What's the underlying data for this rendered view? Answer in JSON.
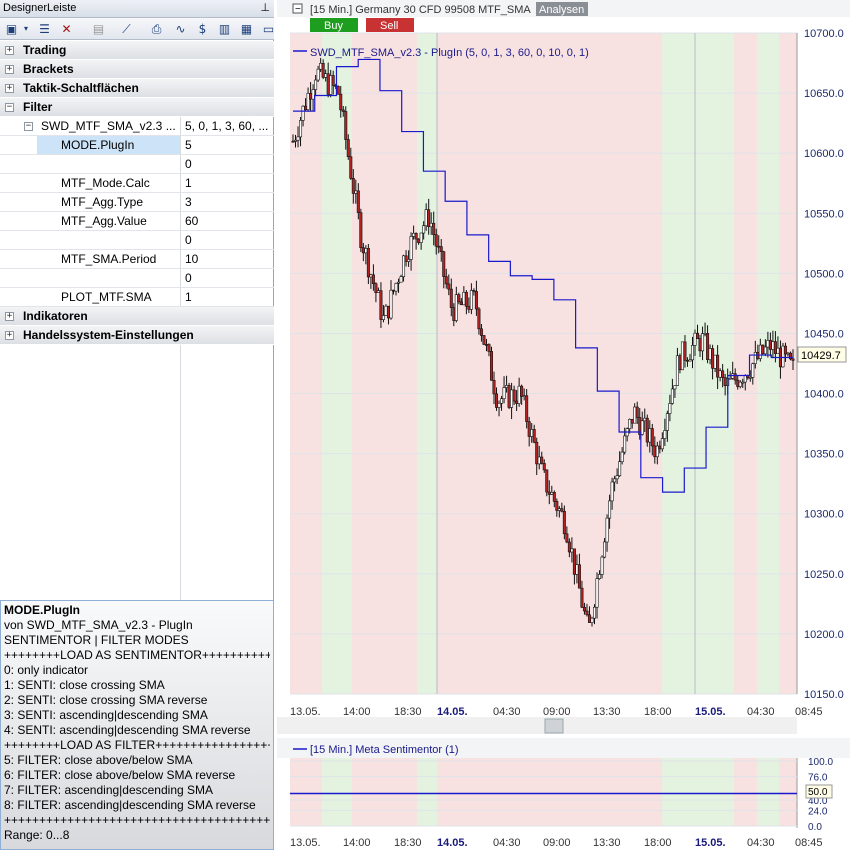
{
  "panel": {
    "title": "DesignerLeiste",
    "categories": {
      "trading": "Trading",
      "brackets": "Brackets",
      "taktik": "Taktik-Schaltflächen",
      "filter": "Filter",
      "indikatoren": "Indikatoren",
      "handelssystem": "Handelssystem-Einstellungen"
    },
    "filter_node": {
      "name": "SWD_MTF_SMA_v2.3 ...",
      "value": "5, 0, 1, 3, 60, ..."
    },
    "params": [
      {
        "name": "MODE.PlugIn",
        "value": "5"
      },
      {
        "name": "",
        "value": "0"
      },
      {
        "name": "MTF_Mode.Calc",
        "value": "1"
      },
      {
        "name": "MTF_Agg.Type",
        "value": "3"
      },
      {
        "name": "MTF_Agg.Value",
        "value": "60"
      },
      {
        "name": "",
        "value": "0"
      },
      {
        "name": "MTF_SMA.Period",
        "value": "10"
      },
      {
        "name": "",
        "value": "0"
      },
      {
        "name": "PLOT_MTF.SMA",
        "value": "1"
      }
    ],
    "description": {
      "title": "MODE.PlugIn",
      "lines": [
        "von SWD_MTF_SMA_v2.3 - PlugIn",
        "SENTIMENTOR | FILTER MODES",
        "++++++++LOAD AS SENTIMENTOR++++++++++",
        "0: only indicator",
        "1: SENTI: close crossing SMA",
        "2: SENTI: close crossing SMA reverse",
        "3: SENTI: ascending|descending SMA",
        "4: SENTI: ascending|descending SMA reverse",
        "++++++++LOAD AS FILTER+++++++++++++++++",
        "5: FILTER: close above/below SMA",
        "6: FILTER: close above/below SMA reverse",
        "7: FILTER: ascending|descending SMA",
        "8: FILTER: ascending|descending SMA reverse",
        "++++++++++++++++++++++++++++++++++++++",
        "Range: 0...8"
      ]
    }
  },
  "chart": {
    "header": "[15 Min.] Germany 30 CFD   99508 MTF_SMA",
    "analysen_label": "Analysen",
    "buy_label": "Buy",
    "sell_label": "Sell",
    "legend": "SWD_MTF_SMA_v2.3 - PlugIn  (5, 0, 1, 3, 60, 0, 10, 0, 1)",
    "last_price": "10429.7",
    "colors": {
      "up": "#ffffff",
      "down": "#b22222",
      "sma": "#1a1acd",
      "bull_zone": "#e3f3e0",
      "bear_zone": "#f8e1e1",
      "buy_btn": "#1e9e1e",
      "sell_btn": "#c83232"
    },
    "sub_header": "[15 Min.] Meta Sentimentor  (1)",
    "sub_value": "50.0",
    "sub_ticks": [
      "100.0",
      "76.0",
      "50.0",
      "40.0",
      "24.0",
      "0.0"
    ],
    "x_ticks": [
      "13.05.",
      "14:00",
      "18:30",
      "14.05.",
      "04:30",
      "09:00",
      "13:30",
      "18:00",
      "15.05.",
      "04:30",
      "08:45"
    ]
  },
  "chart_data": {
    "type": "line",
    "title": "",
    "ylim": [
      10150,
      10700
    ],
    "y_ticks": [
      10700,
      10650,
      10600,
      10550,
      10500,
      10450,
      10400,
      10350,
      10300,
      10250,
      10200,
      10150
    ],
    "x_ticks": [
      "13.05.",
      "14:00",
      "18:30",
      "14.05.",
      "04:30",
      "09:00",
      "13:30",
      "18:00",
      "15.05.",
      "04:30",
      "08:45"
    ],
    "series": [
      {
        "name": "SWD_MTF_SMA_v2.3 - PlugIn",
        "values": [
          10635,
          10648,
          10672,
          10678,
          10652,
          10618,
          10585,
          10560,
          10532,
          10510,
          10498,
          10495,
          10478,
          10438,
          10402,
          10368,
          10330,
          10318,
          10338,
          10372,
          10415,
          10432,
          10430
        ]
      },
      {
        "name": "Germany 30 CFD close",
        "values": [
          10610,
          10668,
          10650,
          10530,
          10460,
          10520,
          10548,
          10470,
          10478,
          10395,
          10400,
          10330,
          10292,
          10200,
          10320,
          10385,
          10352,
          10430,
          10445,
          10405,
          10420,
          10440,
          10420
        ]
      }
    ],
    "last_price": 10429.7
  }
}
